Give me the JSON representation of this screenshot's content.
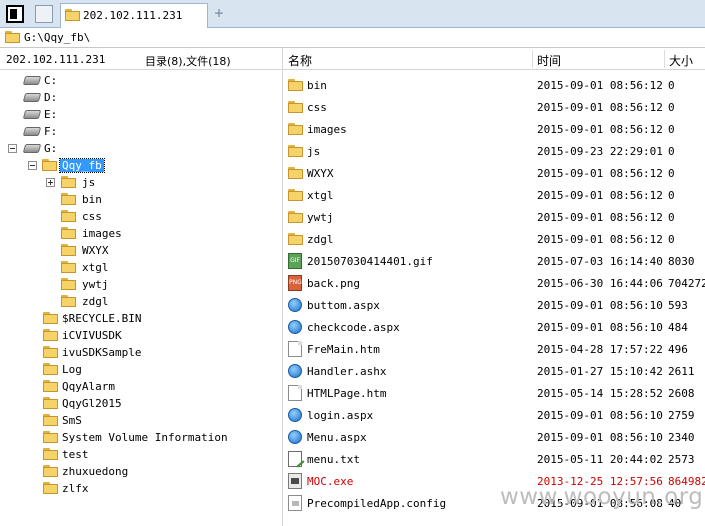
{
  "tab": {
    "label": "202.102.111.231"
  },
  "address": {
    "path": "G:\\Qqy_fb\\"
  },
  "left_header": {
    "ip": "202.102.111.231",
    "counts": "目录(8),文件(18)"
  },
  "tree": {
    "drives": [
      "C:",
      "D:",
      "E:",
      "F:",
      "G:"
    ],
    "selected": "Qqy_fb",
    "qqy_children": [
      "js",
      "bin",
      "css",
      "images",
      "WXYX",
      "xtgl",
      "ywtj",
      "zdgl"
    ],
    "g_children": [
      "$RECYCLE.BIN",
      "iCVIVUSDK",
      "ivuSDKSample",
      "Log",
      "QqyAlarm",
      "QqyGl2015",
      "SmS",
      "System Volume Information",
      "test",
      "zhuxuedong",
      "zlfx"
    ]
  },
  "columns": {
    "name": "名称",
    "time": "时间",
    "size": "大小"
  },
  "files": [
    {
      "name": "bin",
      "date": "2015-09-01 08:56:12",
      "size": "0",
      "icon": "folder-icon"
    },
    {
      "name": "css",
      "date": "2015-09-01 08:56:12",
      "size": "0",
      "icon": "folder-icon"
    },
    {
      "name": "images",
      "date": "2015-09-01 08:56:12",
      "size": "0",
      "icon": "folder-icon"
    },
    {
      "name": "js",
      "date": "2015-09-23 22:29:01",
      "size": "0",
      "icon": "folder-icon"
    },
    {
      "name": "WXYX",
      "date": "2015-09-01 08:56:12",
      "size": "0",
      "icon": "folder-icon"
    },
    {
      "name": "xtgl",
      "date": "2015-09-01 08:56:12",
      "size": "0",
      "icon": "folder-icon"
    },
    {
      "name": "ywtj",
      "date": "2015-09-01 08:56:12",
      "size": "0",
      "icon": "folder-icon"
    },
    {
      "name": "zdgl",
      "date": "2015-09-01 08:56:12",
      "size": "0",
      "icon": "folder-icon"
    },
    {
      "name": "201507030414401.gif",
      "date": "2015-07-03 16:14:40",
      "size": "8030",
      "icon": "gif-file-icon"
    },
    {
      "name": "back.png",
      "date": "2015-06-30 16:44:06",
      "size": "704272",
      "icon": "png-file-icon"
    },
    {
      "name": "buttom.aspx",
      "date": "2015-09-01 08:56:10",
      "size": "593",
      "icon": "globe-file-icon"
    },
    {
      "name": "checkcode.aspx",
      "date": "2015-09-01 08:56:10",
      "size": "484",
      "icon": "globe-file-icon"
    },
    {
      "name": "FreMain.htm",
      "date": "2015-04-28 17:57:22",
      "size": "496",
      "icon": "document-icon"
    },
    {
      "name": "Handler.ashx",
      "date": "2015-01-27 15:10:42",
      "size": "2611",
      "icon": "globe-file-icon"
    },
    {
      "name": "HTMLPage.htm",
      "date": "2015-05-14 15:28:52",
      "size": "2608",
      "icon": "document-icon"
    },
    {
      "name": "login.aspx",
      "date": "2015-09-01 08:56:10",
      "size": "2759",
      "icon": "globe-file-icon"
    },
    {
      "name": "Menu.aspx",
      "date": "2015-09-01 08:56:10",
      "size": "2340",
      "icon": "globe-file-icon"
    },
    {
      "name": "menu.txt",
      "date": "2015-05-11 20:44:02",
      "size": "2573",
      "icon": "text-file-icon"
    },
    {
      "name": "MOC.exe",
      "date": "2013-12-25 12:57:56",
      "size": "864982",
      "icon": "exe-file-icon",
      "highlight": true
    },
    {
      "name": "PrecompiledApp.config",
      "date": "2015-09-01 08:56:08",
      "size": "40",
      "icon": "config-file-icon"
    }
  ],
  "watermark": "www.wooyun.org",
  "colors": {
    "selection": "#3399ff",
    "highlight_text": "#d40000",
    "tabbar": "#d9e4f1"
  }
}
